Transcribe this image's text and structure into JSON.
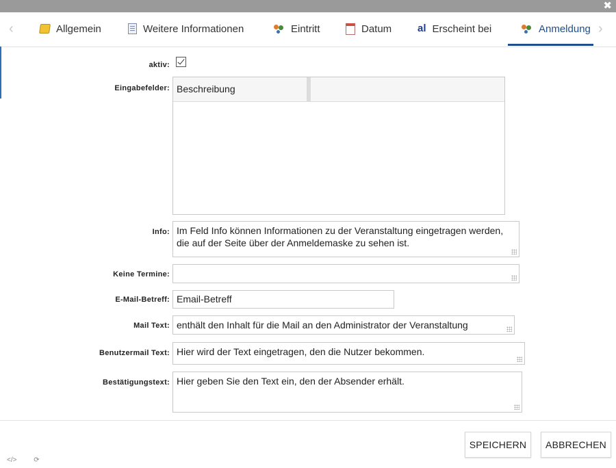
{
  "dialog": {
    "close_glyph": "✖"
  },
  "tabs": {
    "prev_glyph": "‹",
    "next_glyph": "›",
    "items": [
      {
        "label": "Allgemein",
        "icon": "folder-icon"
      },
      {
        "label": "Weitere Informationen",
        "icon": "document-icon"
      },
      {
        "label": "Eintritt",
        "icon": "people-icon"
      },
      {
        "label": "Datum",
        "icon": "calendar-icon"
      },
      {
        "label": "Erscheint bei",
        "icon": "al-icon"
      },
      {
        "label": "Anmeldung",
        "icon": "people-icon",
        "active": true
      }
    ]
  },
  "form": {
    "aktiv_label": "aktiv:",
    "aktiv_checked": true,
    "eingabefelder_label": "Eingabefelder:",
    "eingabefelder_col1": "Beschreibung",
    "info_label": "Info:",
    "info_value": "Im Feld Info können Informationen zu der Veranstaltung eingetragen werden, die auf der Seite über der Anmeldemaske zu sehen ist.",
    "keine_termine_label": "Keine Termine:",
    "keine_termine_value": "",
    "email_betreff_label": "E-Mail-Betreff:",
    "email_betreff_value": "Email-Betreff",
    "mail_text_label": "Mail Text:",
    "mail_text_value": "enthält den Inhalt für die Mail an den Administrator der Veranstaltung",
    "benutzermail_label": "Benutzermail Text:",
    "benutzermail_value": "Hier wird der Text eingetragen, den die Nutzer bekommen.",
    "bestaetigung_label": "Bestätigungstext:",
    "bestaetigung_value": "Hier geben Sie den Text ein, den der Absender erhält."
  },
  "footer": {
    "save_label": "SPEICHERN",
    "cancel_label": "ABBRECHEN",
    "code_glyph": "</>",
    "refresh_glyph": "⟳"
  },
  "colors": {
    "accent": "#1e4e8c",
    "titlebar": "#9a9a9a"
  }
}
